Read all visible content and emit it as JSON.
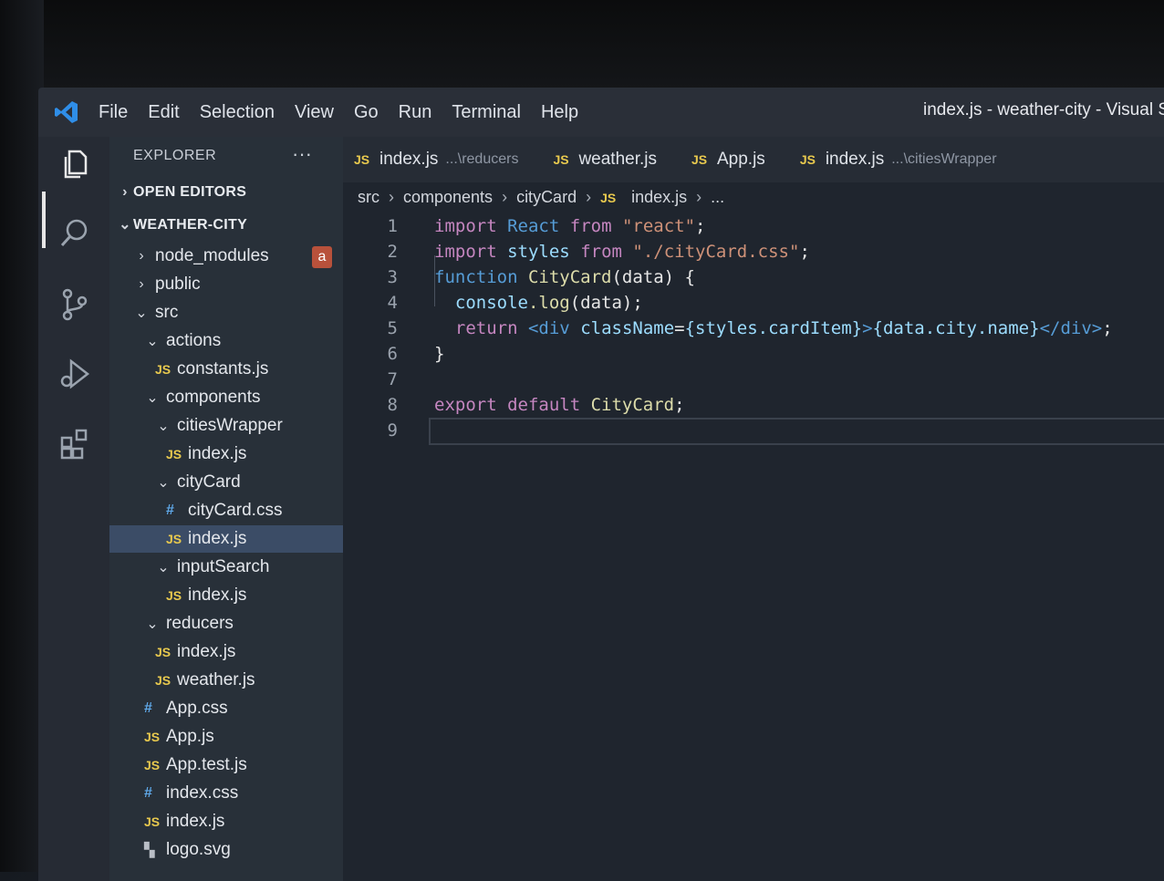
{
  "window": {
    "title": "index.js - weather-city - Visual S"
  },
  "menu": [
    "File",
    "Edit",
    "Selection",
    "View",
    "Go",
    "Run",
    "Terminal",
    "Help"
  ],
  "activity_bar": [
    "explorer-icon",
    "search-icon",
    "source-control-icon",
    "run-debug-icon",
    "extensions-icon"
  ],
  "sidebar": {
    "header": "EXPLORER",
    "more": "···",
    "open_editors": "OPEN EDITORS",
    "project": "WEATHER-CITY",
    "badge": "a",
    "tree": [
      {
        "label": "node_modules",
        "type": "folder",
        "open": false,
        "depth": 1
      },
      {
        "label": "public",
        "type": "folder",
        "open": false,
        "depth": 1
      },
      {
        "label": "src",
        "type": "folder",
        "open": true,
        "depth": 1
      },
      {
        "label": "actions",
        "type": "folder",
        "open": true,
        "depth": 2
      },
      {
        "label": "constants.js",
        "type": "js",
        "depth": 3
      },
      {
        "label": "components",
        "type": "folder",
        "open": true,
        "depth": 2
      },
      {
        "label": "citiesWrapper",
        "type": "folder",
        "open": true,
        "depth": 3
      },
      {
        "label": "index.js",
        "type": "js",
        "depth": 4
      },
      {
        "label": "cityCard",
        "type": "folder",
        "open": true,
        "depth": 3
      },
      {
        "label": "cityCard.css",
        "type": "css",
        "depth": 4
      },
      {
        "label": "index.js",
        "type": "js",
        "depth": 4,
        "selected": true
      },
      {
        "label": "inputSearch",
        "type": "folder",
        "open": true,
        "depth": 3
      },
      {
        "label": "index.js",
        "type": "js",
        "depth": 4
      },
      {
        "label": "reducers",
        "type": "folder",
        "open": true,
        "depth": 2
      },
      {
        "label": "index.js",
        "type": "js",
        "depth": 3
      },
      {
        "label": "weather.js",
        "type": "js",
        "depth": 3
      },
      {
        "label": "App.css",
        "type": "css",
        "depth": 2
      },
      {
        "label": "App.js",
        "type": "js",
        "depth": 2
      },
      {
        "label": "App.test.js",
        "type": "js",
        "depth": 2
      },
      {
        "label": "index.css",
        "type": "css",
        "depth": 2
      },
      {
        "label": "index.js",
        "type": "js",
        "depth": 2
      },
      {
        "label": "logo.svg",
        "type": "svg",
        "depth": 2
      }
    ]
  },
  "tabs": [
    {
      "label": "index.js",
      "desc": "...\\reducers"
    },
    {
      "label": "weather.js",
      "desc": ""
    },
    {
      "label": "App.js",
      "desc": ""
    },
    {
      "label": "index.js",
      "desc": "...\\citiesWrapper"
    }
  ],
  "breadcrumb": [
    "src",
    "components",
    "cityCard",
    "index.js",
    "..."
  ],
  "code": {
    "line_numbers": [
      "1",
      "2",
      "3",
      "4",
      "5",
      "6",
      "7",
      "8",
      "9"
    ],
    "l1": {
      "kw": "import",
      "name": "React",
      "from": "from",
      "str": "\"react\"",
      "end": ";"
    },
    "l2": {
      "kw": "import",
      "name": "styles",
      "from": "from",
      "str": "\"./cityCard.css\"",
      "end": ";"
    },
    "l3": {
      "kw": "function",
      "name": "CityCard",
      "rest": "(data) {"
    },
    "l4": {
      "obj": "console",
      "fn": ".log",
      "rest": "(data);"
    },
    "l5": {
      "kw": "return",
      "open": "<div",
      "attr": "className",
      "eq": "=",
      "expr1": "{styles.cardItem}",
      "gt": ">",
      "expr2": "{data.city.name}",
      "close": "</div>",
      "end": ";"
    },
    "l6": "}",
    "l8": {
      "kw": "export default",
      "name": "CityCard",
      "end": ";"
    }
  }
}
